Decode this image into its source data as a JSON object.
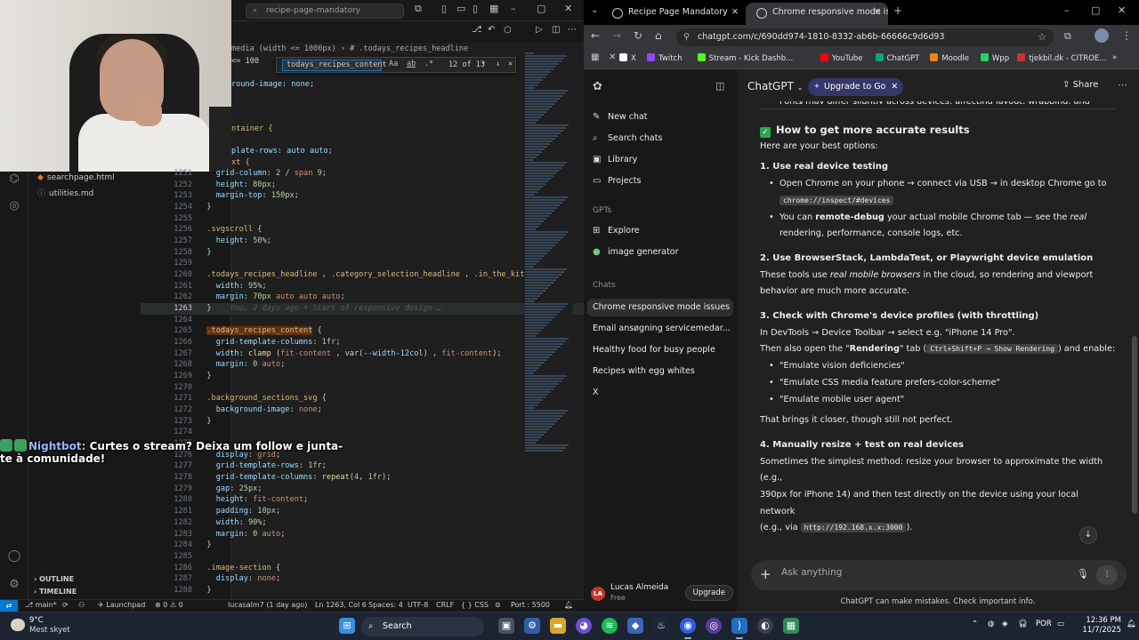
{
  "vscode": {
    "search_text": "recipe-page-mandatory",
    "breadcrumb_prefix": "media (width <= 1000px)",
    "breadcrumb_item": ".todays_recipes_headline",
    "find_query": "todays_recipes_content",
    "find_opt_case": "Aa",
    "find_opt_word": "ab",
    "find_opt_regex": ".*",
    "find_count": "12 of 13",
    "partial_lines": [
      "media (width <= 1000px)",
      "<= 100",
      "round-image: none;",
      "ntainer {",
      "plate-rows: auto auto;",
      "xt {"
    ],
    "explorer_files": [
      "searchpage.html",
      "utilities.md"
    ],
    "outline_label": "OUTLINE",
    "timeline_label": "TIMELINE",
    "code_lines": [
      {
        "n": "1251",
        "html": "    <span class='prop'>grid-column</span>: <span class='num'>2</span> / <span class='val'>span</span> <span class='num'>9</span>;"
      },
      {
        "n": "1252",
        "html": "    <span class='prop'>height</span>: <span class='num'>80px</span>;"
      },
      {
        "n": "1253",
        "html": "    <span class='prop'>margin-top</span>: <span class='num'>150px</span>;"
      },
      {
        "n": "1254",
        "html": "  }"
      },
      {
        "n": "1255",
        "html": ""
      },
      {
        "n": "1256",
        "html": "  <span class='sel'>.svgscroll</span> {"
      },
      {
        "n": "1257",
        "html": "    <span class='prop'>height</span>: <span class='num'>50%</span>;"
      },
      {
        "n": "1258",
        "html": "  }"
      },
      {
        "n": "1259",
        "html": ""
      },
      {
        "n": "1260",
        "html": "  <span class='sel'>.todays_recipes_headline</span> , <span class='sel'>.category_selection_headline</span> , <span class='sel'>.in_the_kitchen</span>"
      },
      {
        "n": "1261",
        "html": "    <span class='prop'>width</span>: <span class='num'>95%</span>;"
      },
      {
        "n": "1262",
        "html": "    <span class='prop'>margin</span>: <span class='num'>70px</span> <span class='val'>auto auto auto</span>;"
      },
      {
        "n": "1263",
        "html": "  }    <span class='ghost'>You, 2 days ago • Start of responsive design …</span>"
      },
      {
        "n": "1264",
        "html": ""
      },
      {
        "n": "1265",
        "html": "  <span class='sel' style='background:#613214'>.todays_recipes_content</span> {"
      },
      {
        "n": "1266",
        "html": "    <span class='prop'>grid-template-columns</span>: <span class='num'>1fr</span>;"
      },
      {
        "n": "1267",
        "html": "    <span class='prop'>width</span>: <span class='fn'>clamp</span> (<span class='val'>fit-content</span> , <span class='fn'>var</span>(<span class='prop'>--width-12col</span>) , <span class='val'>fit-content</span>);"
      },
      {
        "n": "1268",
        "html": "    <span class='prop'>margin</span>: <span class='num'>0</span> <span class='val'>auto</span>;"
      },
      {
        "n": "1269",
        "html": "  }"
      },
      {
        "n": "1270",
        "html": ""
      },
      {
        "n": "1271",
        "html": "  <span class='sel'>.background_sections_svg</span> {"
      },
      {
        "n": "1272",
        "html": "    <span class='prop'>background-image</span>: <span class='val'>none</span>;"
      },
      {
        "n": "1273",
        "html": "  }"
      },
      {
        "n": "1274",
        "html": ""
      },
      {
        "n": "1275",
        "html": ""
      },
      {
        "n": "1276",
        "html": "    <span class='prop'>display</span>: <span class='val'>grid</span>;"
      },
      {
        "n": "1277",
        "html": "    <span class='prop'>grid-template-rows</span>: <span class='num'>1fr</span>;"
      },
      {
        "n": "1278",
        "html": "    <span class='prop'>grid-template-columns</span>: <span class='fn'>repeat</span>(<span class='num'>4</span>, <span class='num'>1fr</span>);"
      },
      {
        "n": "1279",
        "html": "    <span class='prop'>gap</span>: <span class='num'>25px</span>;"
      },
      {
        "n": "1280",
        "html": "    <span class='prop'>height</span>: <span class='val'>fit-content</span>;"
      },
      {
        "n": "1281",
        "html": "    <span class='prop'>padding</span>: <span class='num'>10px</span>;"
      },
      {
        "n": "1282",
        "html": "    <span class='prop'>width</span>: <span class='num'>90%</span>;"
      },
      {
        "n": "1283",
        "html": "    <span class='prop'>margin</span>: <span class='num'>0</span> <span class='val'>auto</span>;"
      },
      {
        "n": "1284",
        "html": "  }"
      },
      {
        "n": "1285",
        "html": ""
      },
      {
        "n": "1286",
        "html": "  <span class='sel'>.image-section</span> {"
      },
      {
        "n": "1287",
        "html": "    <span class='prop'>display</span>: <span class='val'>none</span>;"
      },
      {
        "n": "1288",
        "html": "  }"
      }
    ],
    "status": {
      "branch": "main*",
      "launchpad": "Launchpad",
      "problems": "0 ⚠ 0",
      "blame": "lucasalm7 (1 day ago)",
      "position": "Ln 1263, Col 6",
      "spaces": "Spaces: 4",
      "encoding": "UTF-8",
      "eol": "CRLF",
      "lang": "{ } CSS",
      "port": "Port : 5500"
    }
  },
  "stream_chat": {
    "user": "Nightbot:",
    "message": "Curtes o stream? Deixa um follow e junta-te à comunidade!"
  },
  "chrome": {
    "tabs": [
      {
        "label": "Recipe Page Mandatory",
        "active": false
      },
      {
        "label": "Chrome responsive mode issu",
        "active": true
      }
    ],
    "url": "chatgpt.com/c/690dd974-1810-8332-ab6b-66666c9d6d93",
    "bookmarks": [
      "X",
      "Twitch",
      "Stream - Kick Dashb...",
      "YouTube",
      "ChatGPT",
      "Moodle",
      "Wpp",
      "tjekbil.dk - CITROE..."
    ]
  },
  "chatgpt": {
    "model": "ChatGPT",
    "upgrade_pill": "Upgrade to Go",
    "share": "Share",
    "sidebar": {
      "new_chat": "New chat",
      "search_chats": "Search chats",
      "library": "Library",
      "projects": "Projects",
      "gpts_head": "GPTs",
      "explore": "Explore",
      "image_generator": "image generator",
      "chats_head": "Chats",
      "chats": [
        "Chrome responsive mode issues",
        "Email ansøgning servicemedar...",
        "Healthy food for busy people",
        "Recipes with egg whites",
        "X"
      ]
    },
    "user": {
      "name": "Lucas Almeida",
      "plan": "Free",
      "upgrade": "Upgrade"
    },
    "composer_placeholder": "Ask anything",
    "disclaimer": "ChatGPT can make mistakes. Check important info.",
    "top_cut": "Fonts may differ slightly across devices, affecting layout, wrapping, and spacing.",
    "heading": "How to get more accurate results",
    "intro": "Here are your best options:",
    "s1_title": "1. Use real device testing",
    "s1_b1a": "Open Chrome on your phone → connect via USB → in desktop Chrome go to",
    "s1_b1_code": "chrome://inspect/#devices",
    "s1_b2a": "You can ",
    "s1_b2_bold": "remote-debug",
    "s1_b2b": " your actual mobile Chrome tab — see the ",
    "s1_b2_it": "real",
    "s1_b2c": "rendering, performance, console logs, etc.",
    "s2_title": "2. Use BrowserStack, LambdaTest, or Playwright device emulation",
    "s2_a": "These tools use ",
    "s2_it": "real mobile browsers",
    "s2_b": " in the cloud, so rendering and viewport",
    "s2_c": "behavior are much more accurate.",
    "s3_title": "3. Check with Chrome's device profiles (with throttling)",
    "s3_a": "In DevTools → Device Toolbar → select e.g. \"iPhone 14 Pro\".",
    "s3_b1": "Then also open the \"",
    "s3_b_bold": "Rendering",
    "s3_b2": "\" tab (",
    "s3_code": "Ctrl+Shift+P → Show Rendering",
    "s3_b3": ") and enable:",
    "s3_items": [
      "\"Emulate vision deficiencies\"",
      "\"Emulate CSS media feature prefers-color-scheme\"",
      "\"Emulate mobile user agent\""
    ],
    "s3_after": "That brings it closer, though still not perfect.",
    "s4_title": "4. Manually resize + test on real devices",
    "s4_a": "Sometimes the simplest method: resize your browser to approximate the width (e.g.,",
    "s4_b": "390px for iPhone 14) and then test directly on the device using your local network",
    "s4_c1": "(e.g., via ",
    "s4_code": "http://192.168.x.x:3000",
    "s4_c2": ")."
  },
  "taskbar": {
    "temp": "9°C",
    "weather": "Mest skyet",
    "search": "Search",
    "lang": "POR",
    "time": "12:36 PM",
    "date": "11/7/2025"
  }
}
